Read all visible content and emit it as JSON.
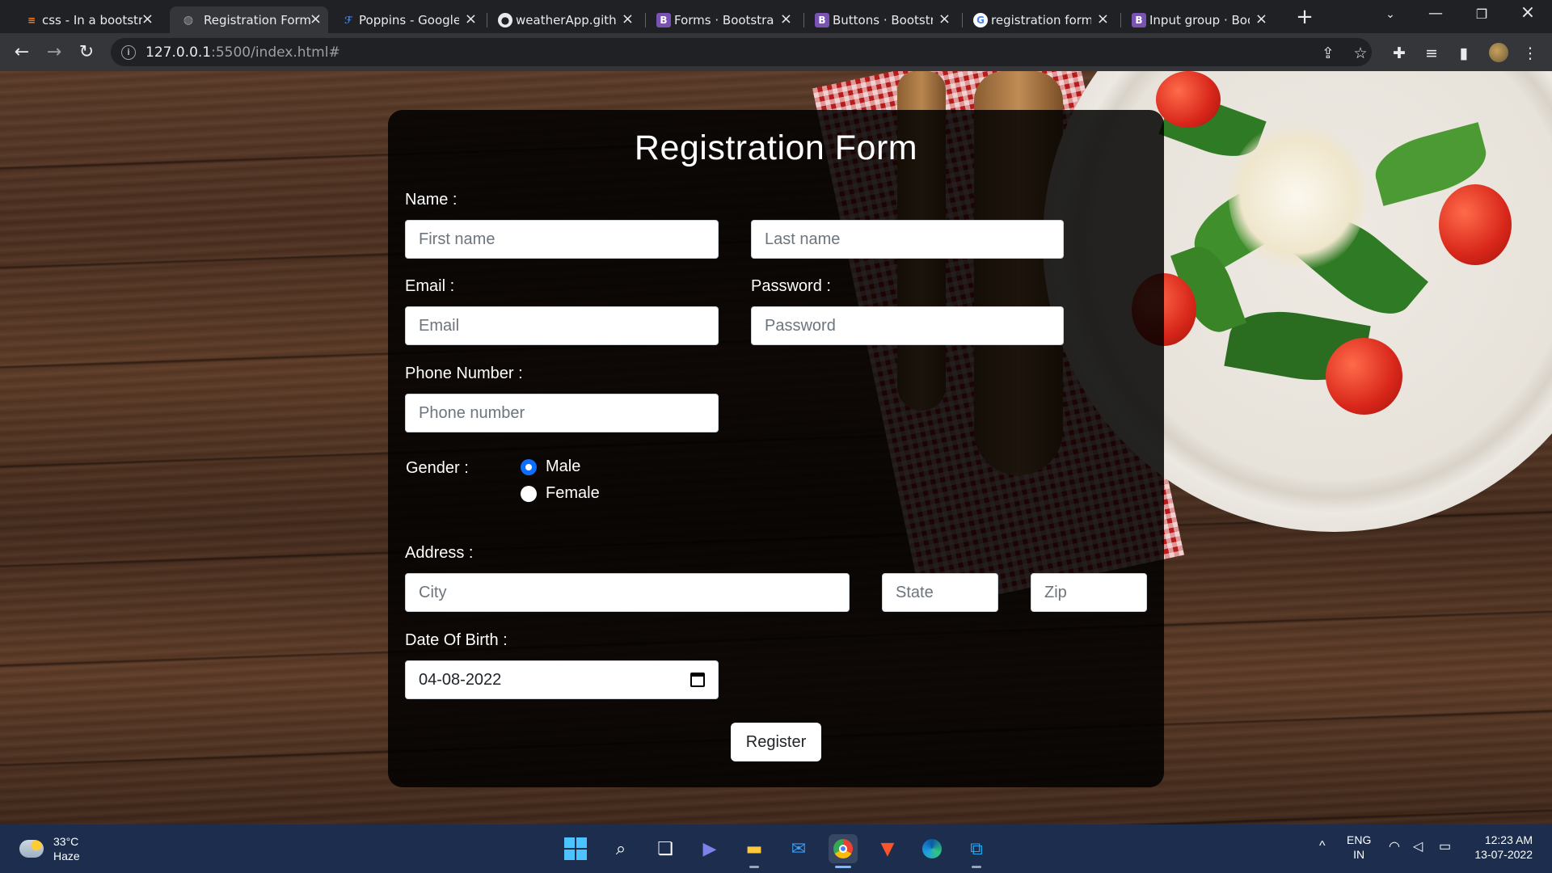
{
  "browser": {
    "tabs": [
      {
        "title": "css - In a bootstra",
        "favicon": "stackoverflow-icon",
        "active": false
      },
      {
        "title": "Registration Form",
        "favicon": "globe-icon",
        "active": true
      },
      {
        "title": "Poppins - Google",
        "favicon": "google-fonts-icon",
        "active": false
      },
      {
        "title": "weatherApp.githu",
        "favicon": "github-icon",
        "active": false
      },
      {
        "title": "Forms · Bootstrap",
        "favicon": "bootstrap-icon",
        "active": false
      },
      {
        "title": "Buttons · Bootstra",
        "favicon": "bootstrap-icon",
        "active": false
      },
      {
        "title": "registration form",
        "favicon": "google-icon",
        "active": false
      },
      {
        "title": "Input group · Boo",
        "favicon": "bootstrap-icon",
        "active": false
      }
    ],
    "url_host": "127.0.0.1",
    "url_path": ":5500/index.html#",
    "bootstrap_favicon_letter": "B"
  },
  "form": {
    "title": "Registration Form",
    "name_label": "Name :",
    "first_name_placeholder": "First name",
    "last_name_placeholder": "Last name",
    "email_label": "Email :",
    "email_placeholder": "Email",
    "password_label": "Password :",
    "password_placeholder": "Password",
    "phone_label": "Phone Number :",
    "phone_placeholder": "Phone number",
    "gender_label": "Gender :",
    "gender_options": [
      {
        "label": "Male",
        "checked": true
      },
      {
        "label": "Female",
        "checked": false
      }
    ],
    "address_label": "Address :",
    "city_placeholder": "City",
    "state_placeholder": "State",
    "zip_placeholder": "Zip",
    "dob_label": "Date Of Birth :",
    "dob_value": "04-08-2022",
    "register_label": "Register"
  },
  "taskbar": {
    "weather_temp": "33°C",
    "weather_desc": "Haze",
    "lang_top": "ENG",
    "lang_bottom": "IN",
    "time": "12:23 AM",
    "date": "13-07-2022"
  },
  "colors": {
    "accent_radio": "#0d6efd",
    "card_bg": "rgba(0,0,0,0.85)",
    "taskbar": "#1c2d4d"
  }
}
